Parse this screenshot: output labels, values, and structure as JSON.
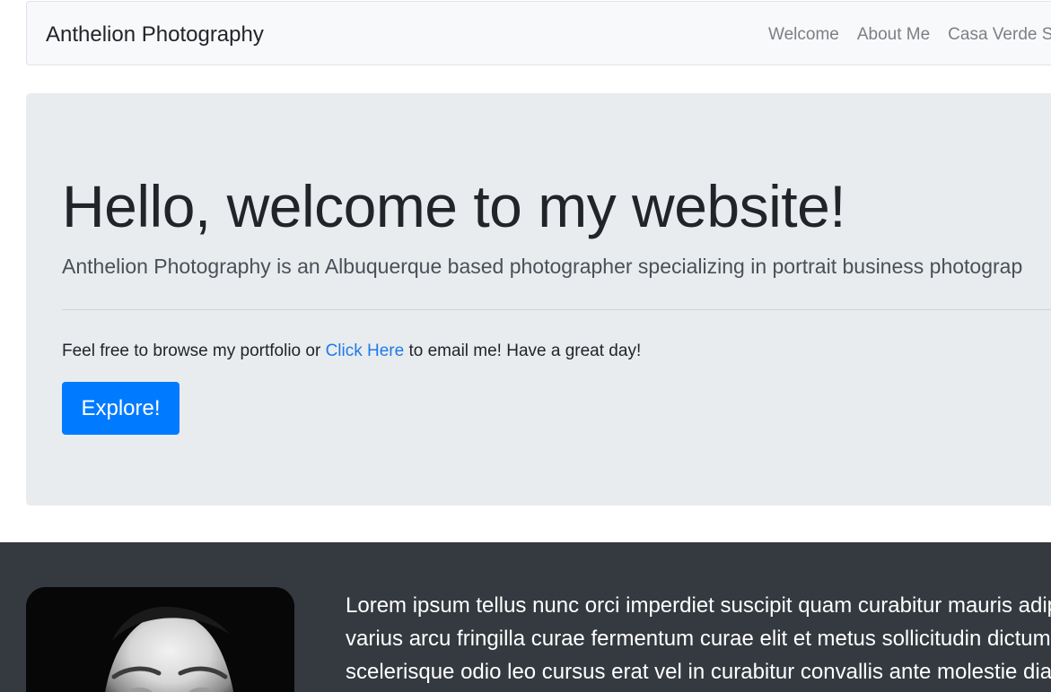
{
  "navbar": {
    "brand": "Anthelion Photography",
    "links": [
      "Welcome",
      "About Me",
      "Casa Verde S"
    ]
  },
  "hero": {
    "title": "Hello, welcome to my website!",
    "lead": "Anthelion Photography is an Albuquerque based photographer specializing in portrait business photograp",
    "text_before_link": "Feel free to browse my portfolio or ",
    "link_label": "Click Here",
    "text_after_link": " to email me! Have a great day!",
    "button_label": "Explore!"
  },
  "about": {
    "lines": [
      "Lorem ipsum tellus nunc orci imperdiet suscipit quam curabitur mauris adipi",
      "varius arcu fringilla curae fermentum curae elit et metus sollicitudin dictum,",
      "scelerisque odio leo cursus erat vel in curabitur convallis ante molestie diam"
    ]
  },
  "colors": {
    "navbar_bg": "#f8f9fa",
    "jumbotron_bg": "#e9ecef",
    "primary": "#007bff",
    "link": "#1f7ae8",
    "dark_section_bg": "#343a40"
  }
}
